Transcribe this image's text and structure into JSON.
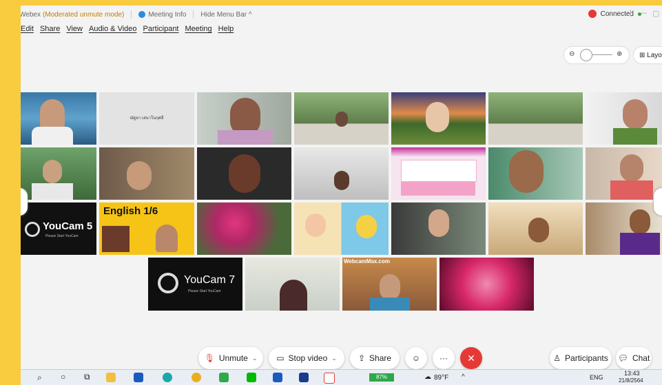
{
  "titlebar": {
    "app": "Webex",
    "mode": "(Moderated unmute mode)",
    "meeting_info": "Meeting Info",
    "hide_menu": "Hide Menu Bar ^",
    "connected": "Connected"
  },
  "menu": [
    "Edit",
    "Share",
    "View",
    "Audio & Video",
    "Participant",
    "Meeting",
    "Help"
  ],
  "zoom": {
    "minus": "⊖",
    "plus": "⊕"
  },
  "layout_label": "⊞ Layo",
  "tiles": {
    "name_tile_label": "ณัฐยา เสนาโนกุศลี",
    "youcam5": "YouCam 5",
    "youcam5_sub": "Please Start YouCam",
    "english": "English 1/6",
    "youcam7": "YouCam 7",
    "youcam7_sub": "Please Start YouCam",
    "webcam_watermark": "WebcamMax.com"
  },
  "controls": {
    "unmute": "Unmute",
    "stop_video": "Stop video",
    "share": "Share",
    "participants": "Participants",
    "chat": "Chat"
  },
  "taskbar": {
    "battery": "87%",
    "temp": "89°F",
    "lang": "ENG",
    "time": "13:43",
    "date": "21/8/2564"
  },
  "colors": {
    "accent_red": "#e53935",
    "yellow_bg": "#f9cc3f",
    "window_bg": "#f3f3f3"
  }
}
